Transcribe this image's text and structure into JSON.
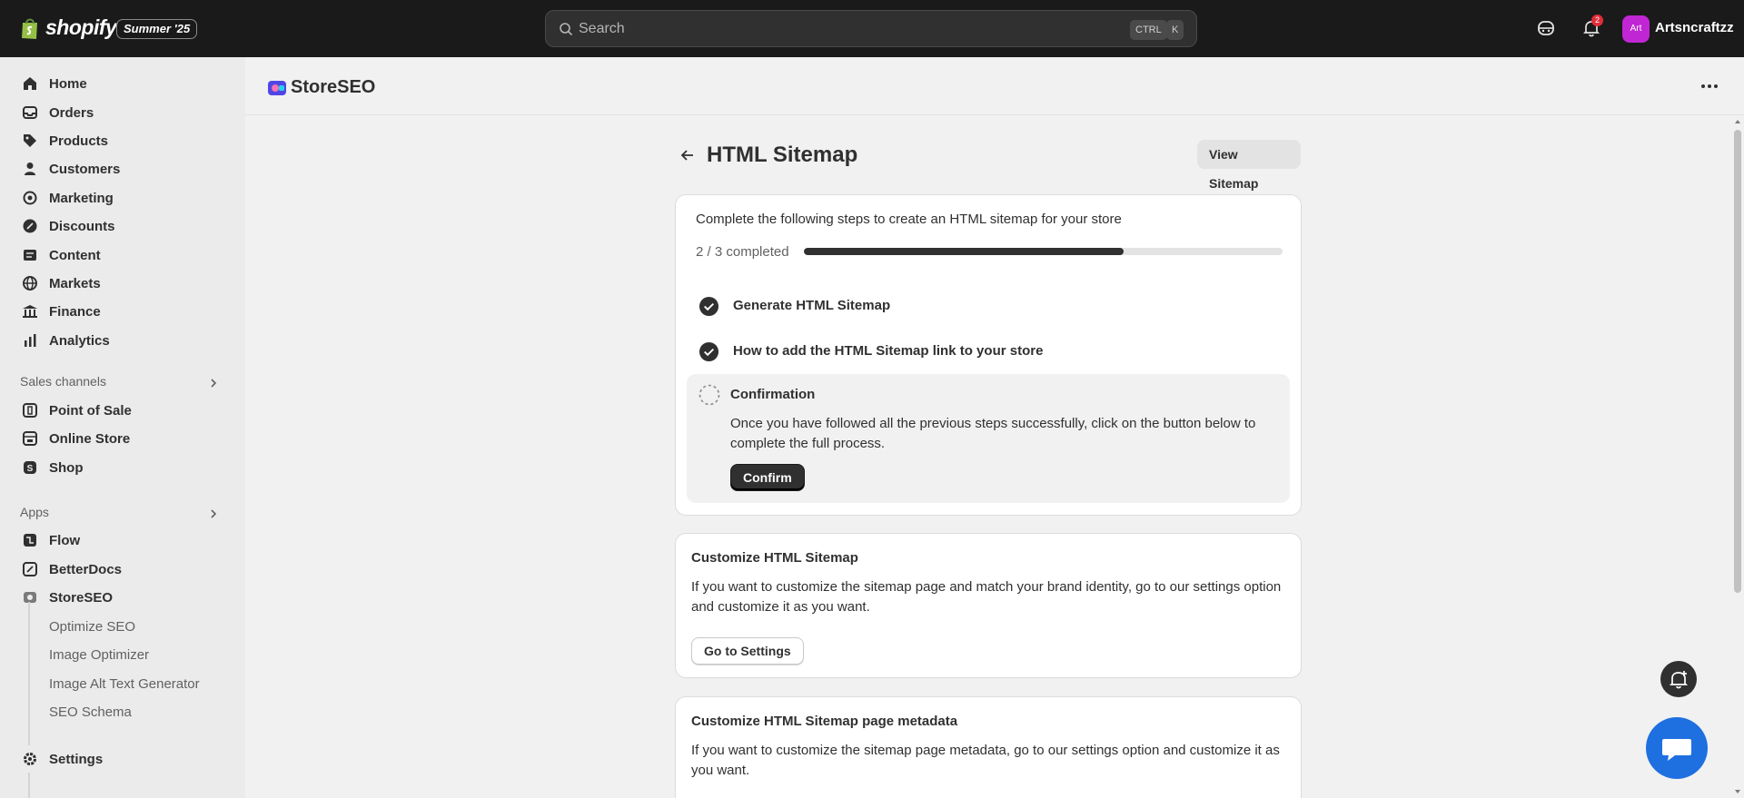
{
  "topbar": {
    "brand": "shopify",
    "edition_badge": "Summer '25",
    "search_placeholder": "Search",
    "shortcut_ctrl": "CTRL",
    "shortcut_k": "K",
    "notification_count": "2",
    "avatar_initials": "Art",
    "store_name": "Artsncraftzz"
  },
  "sidebar": {
    "items": [
      {
        "label": "Home",
        "icon": "home-icon"
      },
      {
        "label": "Orders",
        "icon": "inbox-icon"
      },
      {
        "label": "Products",
        "icon": "tag-icon"
      },
      {
        "label": "Customers",
        "icon": "person-icon"
      },
      {
        "label": "Marketing",
        "icon": "target-icon"
      },
      {
        "label": "Discounts",
        "icon": "discount-icon"
      },
      {
        "label": "Content",
        "icon": "content-icon"
      },
      {
        "label": "Markets",
        "icon": "globe-icon"
      },
      {
        "label": "Finance",
        "icon": "bank-icon"
      },
      {
        "label": "Analytics",
        "icon": "chart-icon"
      }
    ],
    "sales_channels_label": "Sales channels",
    "sales_channels": [
      {
        "label": "Point of Sale"
      },
      {
        "label": "Online Store"
      },
      {
        "label": "Shop"
      }
    ],
    "apps_label": "Apps",
    "apps": [
      {
        "label": "Flow"
      },
      {
        "label": "BetterDocs"
      },
      {
        "label": "StoreSEO"
      }
    ],
    "storeseo_sub": [
      {
        "label": "Optimize SEO"
      },
      {
        "label": "Image Optimizer"
      },
      {
        "label": "Image Alt Text Generator"
      },
      {
        "label": "SEO Schema"
      }
    ],
    "settings_label": "Settings"
  },
  "app_header": {
    "title": "StoreSEO"
  },
  "page": {
    "title": "HTML Sitemap",
    "view_button": "View Sitemap",
    "steps_card": {
      "intro": "Complete the following steps to create an HTML sitemap for your store",
      "progress_text": "2 / 3 completed",
      "progress_fraction": 0.667,
      "steps": [
        {
          "label": "Generate HTML Sitemap",
          "done": true
        },
        {
          "label": "How to add the HTML Sitemap link to your store",
          "done": true
        }
      ],
      "active_step": {
        "title": "Confirmation",
        "description": "Once you have followed all the previous steps successfully, click on the button below to complete the full process.",
        "button": "Confirm"
      }
    },
    "customize_card": {
      "title": "Customize HTML Sitemap",
      "description": "If you want to customize the sitemap page and match your brand identity, go to our settings option and customize it as you want.",
      "button": "Go to Settings"
    },
    "metadata_card": {
      "title": "Customize HTML Sitemap page metadata",
      "description": "If you want to customize the sitemap page metadata, go to our settings option and customize it as you want."
    }
  },
  "colors": {
    "topbar": "#1a1a1a",
    "accent_dark": "#303030",
    "chat_button": "#1e6fe0",
    "avatar": "#c026d3"
  }
}
